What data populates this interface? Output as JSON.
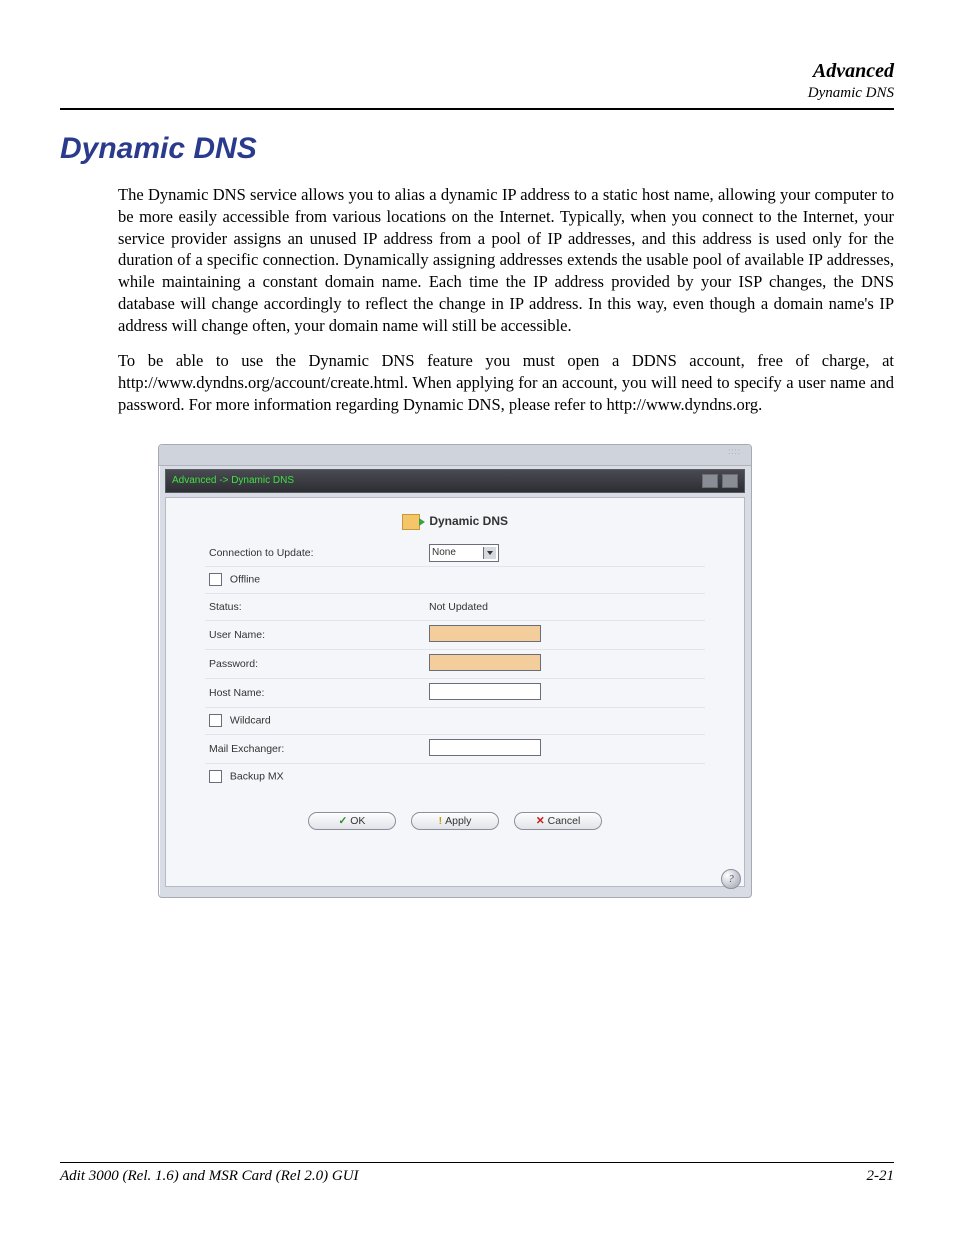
{
  "header": {
    "section": "Advanced",
    "subsection": "Dynamic DNS"
  },
  "title": "Dynamic DNS",
  "paragraphs": [
    "The Dynamic DNS service allows you to alias a dynamic IP address to a static host name, allowing your computer to be more easily accessible from various locations on the Internet. Typically, when you connect to the Internet, your service provider assigns an unused IP address from a pool of IP addresses, and this address is used only for the duration of a specific connection. Dynamically assigning addresses extends the usable pool of available IP addresses, while maintaining a constant domain name. Each time the IP address provided by your ISP changes, the DNS database will change accordingly to reflect the change in IP address. In this way, even though a domain name's IP address will change often, your domain name will still be accessible.",
    "To be able to use the Dynamic DNS feature you must open a DDNS account, free of charge, at http://www.dyndns.org/account/create.html. When applying for an account, you will need to specify a user name and password. For more information regarding Dynamic DNS, please refer to http://www.dyndns.org."
  ],
  "screenshot": {
    "breadcrumb": "Advanced -> Dynamic DNS",
    "panel_title": "Dynamic DNS",
    "fields": {
      "connection_label": "Connection to Update:",
      "connection_value": "None",
      "offline_label": "Offline",
      "status_label": "Status:",
      "status_value": "Not Updated",
      "username_label": "User Name:",
      "password_label": "Password:",
      "hostname_label": "Host Name:",
      "wildcard_label": "Wildcard",
      "mail_exchanger_label": "Mail Exchanger:",
      "backup_mx_label": "Backup MX"
    },
    "buttons": {
      "ok": "OK",
      "apply": "Apply",
      "cancel": "Cancel"
    },
    "help": "?"
  },
  "footer": {
    "left": "Adit 3000 (Rel. 1.6) and MSR Card (Rel 2.0) GUI",
    "right": "2-21"
  }
}
